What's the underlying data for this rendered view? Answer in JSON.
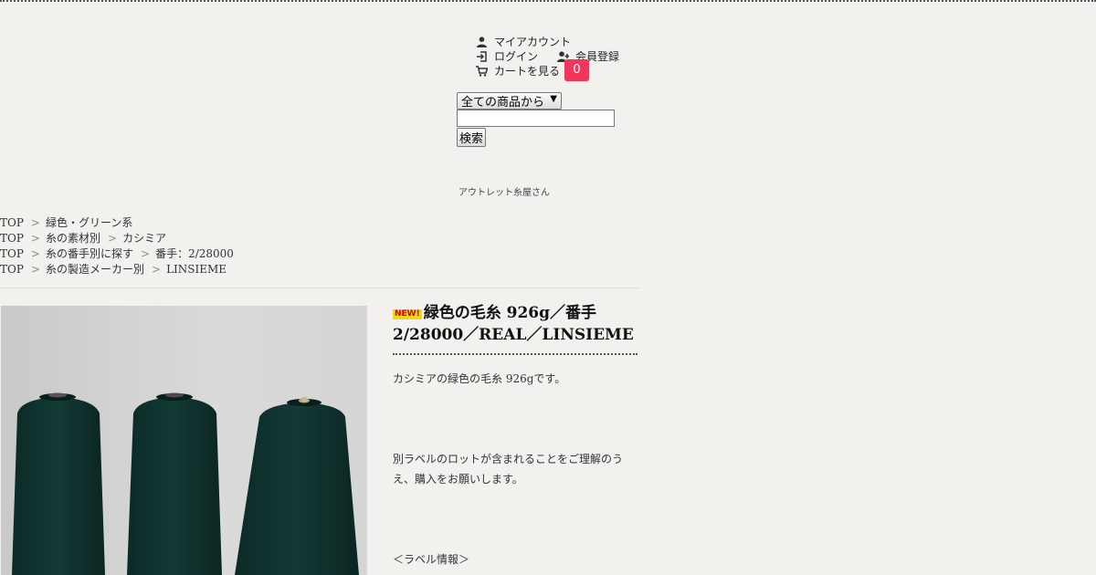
{
  "account": {
    "my_account": "マイアカウント",
    "login": "ログイン",
    "register": "会員登録",
    "view_cart": "カートを見る",
    "cart_count": "0",
    "badge_color": "#f0365a"
  },
  "search": {
    "category_selected": "全ての商品から",
    "query": "",
    "button_label": "検索"
  },
  "logo": {
    "name": "アウトレット糸屋さん"
  },
  "breadcrumbs": [
    {
      "items": [
        "TOP",
        "緑色・グリーン系"
      ]
    },
    {
      "items": [
        "TOP",
        "糸の素材別",
        "カシミア"
      ]
    },
    {
      "items": [
        "TOP",
        "糸の番手別に探す",
        "番手：2/28000"
      ]
    },
    {
      "items": [
        "TOP",
        "糸の製造メーカー別",
        "LINSIEME"
      ]
    }
  ],
  "breadcrumb_separator": ">",
  "product": {
    "new_badge": "NEW!",
    "title": "緑色の毛糸 926g／番手2/28000／REAL／LINSIEME",
    "description_1": "カシミアの緑色の毛糸 926gです。",
    "description_2": "別ラベルのロットが含まれることをご理解のうえ、購入をお願いします。",
    "description_3": "＜ラベル情報＞",
    "image_icon": "green-yarn-cones-photo"
  }
}
